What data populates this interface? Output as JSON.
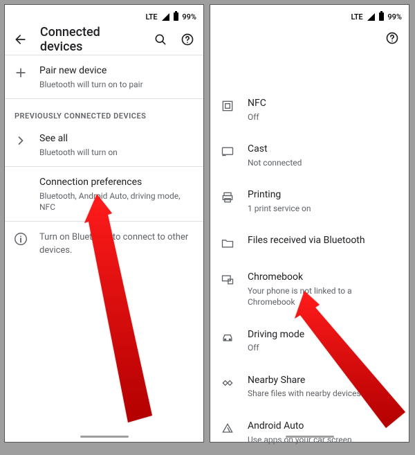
{
  "status": {
    "network": "LTE",
    "battery": "99%"
  },
  "left": {
    "title": "Connected devices",
    "pair": {
      "title": "Pair new device",
      "sub": "Bluetooth will turn on to pair"
    },
    "section_label": "PREVIOUSLY CONNECTED DEVICES",
    "seeall": {
      "title": "See all",
      "sub": "Bluetooth will turn on"
    },
    "connpref": {
      "title": "Connection preferences",
      "sub": "Bluetooth, Android Auto, driving mode, NFC"
    },
    "info": "Turn on Bluetooth to connect to other devices."
  },
  "right": {
    "items": [
      {
        "icon": "nfc-icon",
        "title": "NFC",
        "sub": "Off"
      },
      {
        "icon": "cast-icon",
        "title": "Cast",
        "sub": "Not connected"
      },
      {
        "icon": "print-icon",
        "title": "Printing",
        "sub": "1 print service on"
      },
      {
        "icon": "folder-icon",
        "title": "Files received via Bluetooth",
        "sub": ""
      },
      {
        "icon": "chromebook-icon",
        "title": "Chromebook",
        "sub": "Your phone is not linked to a Chromebook"
      },
      {
        "icon": "car-icon",
        "title": "Driving mode",
        "sub": "Off"
      },
      {
        "icon": "nearby-icon",
        "title": "Nearby Share",
        "sub": "Share files with nearby devices"
      },
      {
        "icon": "androidauto-icon",
        "title": "Android Auto",
        "sub": "Use apps on your car screen"
      }
    ]
  }
}
